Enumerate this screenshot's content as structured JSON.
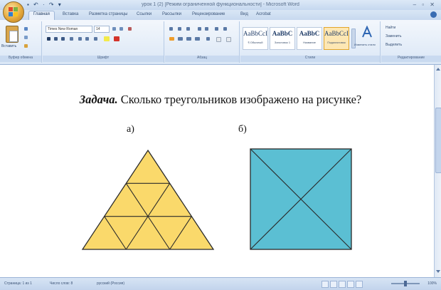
{
  "window": {
    "title": "урок 1 (2) [Режим ограниченной функциональности] - Microsoft Word",
    "quick_access": "▪ ↶ · ↷ ▾",
    "controls": "– ▫ ✕"
  },
  "tabs": [
    "Главная",
    "Вставка",
    "Разметка страницы",
    "Ссылки",
    "Рассылки",
    "Рецензирование",
    "Вид",
    "Acrobat"
  ],
  "ribbon": {
    "paste_label": "Вставить",
    "font_name": "Times New Roman",
    "font_size": "14",
    "group_labels": [
      "Буфер обмена",
      "Шрифт",
      "Абзац",
      "Стили",
      "Редактирование"
    ],
    "styles": [
      {
        "sample": "AaBbCcI",
        "name": "¶ Обычный"
      },
      {
        "sample": "AaBbC",
        "name": "Заголовок 1"
      },
      {
        "sample": "AaBbC",
        "name": "Название"
      },
      {
        "sample": "AaBbCcI",
        "name": "Подзаголовок"
      }
    ],
    "change_styles_label": "Изменить стили",
    "editing": [
      "Найти",
      "Заменить",
      "Выделить"
    ]
  },
  "document": {
    "heading_bold": "Задача.",
    "heading_rest": " Сколько треугольников изображено на рисунке?",
    "label_a": "а)",
    "label_b": "б)"
  },
  "status": {
    "page": "Страница: 1 из 1",
    "words": "Число слов: 8",
    "language": "русский (Россия)",
    "zoom": "100%"
  },
  "colors": {
    "triangle_fill": "#fad96b",
    "square_fill": "#5bbfd3",
    "stroke": "#2a2a2a",
    "ribbon_accent": "#dbe7f6"
  }
}
